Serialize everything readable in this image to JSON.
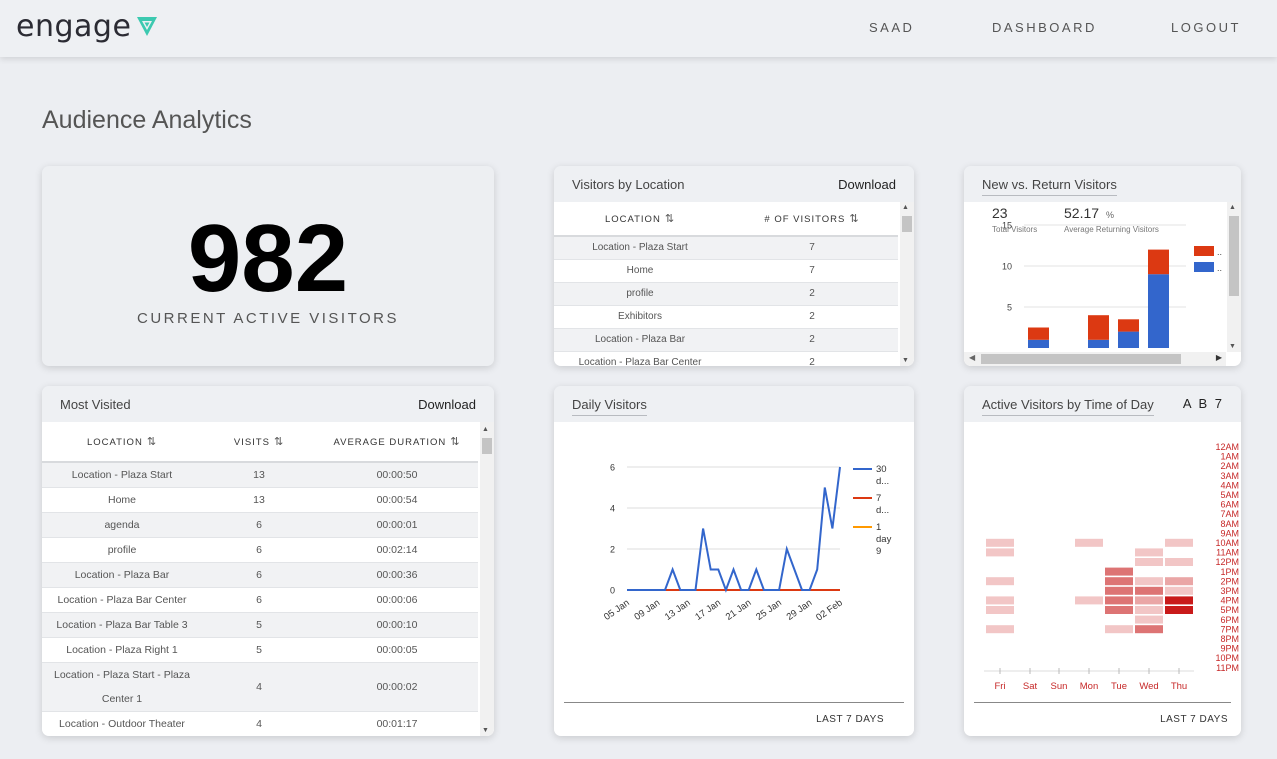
{
  "brand": {
    "name": "engage",
    "accent": "#3cc9b0"
  },
  "nav": {
    "user": "SAAD",
    "dashboard": "DASHBOARD",
    "logout": "LOGOUT"
  },
  "page": {
    "title": "Audience Analytics"
  },
  "active": {
    "count": "982",
    "label": "CURRENT ACTIVE VISITORS"
  },
  "by_location": {
    "title": "Visitors by Location",
    "download": "Download",
    "headers": [
      "LOCATION",
      "# OF VISITORS"
    ],
    "rows": [
      [
        "Location - Plaza Start",
        "7"
      ],
      [
        "Home",
        "7"
      ],
      [
        "profile",
        "2"
      ],
      [
        "Exhibitors",
        "2"
      ],
      [
        "Location - Plaza Bar",
        "2"
      ],
      [
        "Location - Plaza Bar Center",
        "2"
      ]
    ]
  },
  "new_return": {
    "title": "New vs. Return Visitors",
    "total": "23",
    "total_label": "Total Visitors",
    "avg": "52.17",
    "avg_unit": "%",
    "avg_label": "Average Returning Visitors",
    "legend_new": "..",
    "legend_return": "..",
    "colors": {
      "new": "#dc3912",
      "return": "#3366cc"
    },
    "chart_data": {
      "type": "bar",
      "stacked": true,
      "y_ticks": [
        "15",
        "10",
        "5"
      ],
      "series": [
        {
          "key": "return",
          "values": [
            1,
            0,
            1,
            2,
            9
          ]
        },
        {
          "key": "new",
          "values": [
            1.5,
            0,
            3,
            1.5,
            3
          ]
        }
      ]
    }
  },
  "most_visited": {
    "title": "Most Visited",
    "download": "Download",
    "headers": [
      "LOCATION",
      "VISITS",
      "AVERAGE DURATION"
    ],
    "rows": [
      [
        "Location - Plaza Start",
        "13",
        "00:00:50"
      ],
      [
        "Home",
        "13",
        "00:00:54"
      ],
      [
        "agenda",
        "6",
        "00:00:01"
      ],
      [
        "profile",
        "6",
        "00:02:14"
      ],
      [
        "Location - Plaza Bar",
        "6",
        "00:00:36"
      ],
      [
        "Location - Plaza Bar Center",
        "6",
        "00:00:06"
      ],
      [
        "Location - Plaza Bar Table 3",
        "5",
        "00:00:10"
      ],
      [
        "Location - Plaza Right 1",
        "5",
        "00:00:05"
      ],
      [
        "Location - Plaza Start - Plaza Center 1",
        "4",
        "00:00:02"
      ],
      [
        "Location - Outdoor Theater",
        "4",
        "00:01:17"
      ]
    ]
  },
  "daily": {
    "title": "Daily Visitors",
    "footer": "LAST 7 DAYS",
    "legend": [
      {
        "lines": [
          "30",
          "d..."
        ],
        "color": "#3366cc"
      },
      {
        "lines": [
          "7",
          "d..."
        ],
        "color": "#dc3912"
      },
      {
        "lines": [
          "1",
          "day",
          "9"
        ],
        "color": "#ff9900"
      }
    ],
    "chart_data": {
      "type": "line",
      "y_ticks": [
        "6",
        "4",
        "2",
        "0"
      ],
      "ylim": [
        0,
        6
      ],
      "x_labels": [
        "05 Jan",
        "09 Jan",
        "13 Jan",
        "17 Jan",
        "21 Jan",
        "25 Jan",
        "29 Jan",
        "02 Feb"
      ],
      "series": [
        {
          "color": "#3366cc",
          "values": [
            0,
            0,
            0,
            0,
            0,
            0,
            1,
            0,
            0,
            0,
            3,
            1,
            1,
            0,
            1,
            0,
            0,
            1,
            0,
            0,
            0,
            2,
            1,
            0,
            0,
            1,
            5,
            3,
            6
          ]
        },
        {
          "color": "#dc3912",
          "values": [
            0,
            0,
            0,
            0,
            0,
            0,
            0,
            0,
            0,
            0,
            0,
            0,
            0,
            0,
            0,
            0,
            0,
            0,
            0,
            0,
            0,
            0,
            0,
            0,
            0,
            0,
            0,
            0,
            0
          ]
        }
      ]
    }
  },
  "time_of_day": {
    "title": "Active Visitors by Time of Day",
    "controls": [
      "A",
      "B",
      "7"
    ],
    "footer": "LAST 7 DAYS",
    "days": [
      "Fri",
      "Sat",
      "Sun",
      "Mon",
      "Tue",
      "Wed",
      "Thu"
    ],
    "hours": [
      "12AM",
      "1AM",
      "2AM",
      "3AM",
      "4AM",
      "5AM",
      "6AM",
      "7AM",
      "8AM",
      "9AM",
      "10AM",
      "11AM",
      "12PM",
      "1PM",
      "2PM",
      "3PM",
      "4PM",
      "5PM",
      "6PM",
      "7PM",
      "8PM",
      "9PM",
      "10PM",
      "11PM"
    ],
    "chart_data": {
      "type": "heatmap",
      "cells": [
        [
          0,
          10,
          1
        ],
        [
          0,
          11,
          1
        ],
        [
          0,
          14,
          1
        ],
        [
          0,
          16,
          1
        ],
        [
          0,
          17,
          1
        ],
        [
          0,
          19,
          1
        ],
        [
          3,
          10,
          1
        ],
        [
          3,
          16,
          1
        ],
        [
          4,
          13,
          3
        ],
        [
          4,
          14,
          3
        ],
        [
          4,
          15,
          3
        ],
        [
          4,
          16,
          3
        ],
        [
          4,
          17,
          3
        ],
        [
          4,
          19,
          1
        ],
        [
          5,
          11,
          1
        ],
        [
          5,
          12,
          1
        ],
        [
          5,
          14,
          1
        ],
        [
          5,
          15,
          3
        ],
        [
          5,
          16,
          2
        ],
        [
          5,
          17,
          1
        ],
        [
          5,
          18,
          1
        ],
        [
          5,
          19,
          3
        ],
        [
          6,
          10,
          1
        ],
        [
          6,
          12,
          1
        ],
        [
          6,
          14,
          2
        ],
        [
          6,
          15,
          1
        ],
        [
          6,
          16,
          4
        ],
        [
          6,
          17,
          4
        ]
      ]
    }
  }
}
